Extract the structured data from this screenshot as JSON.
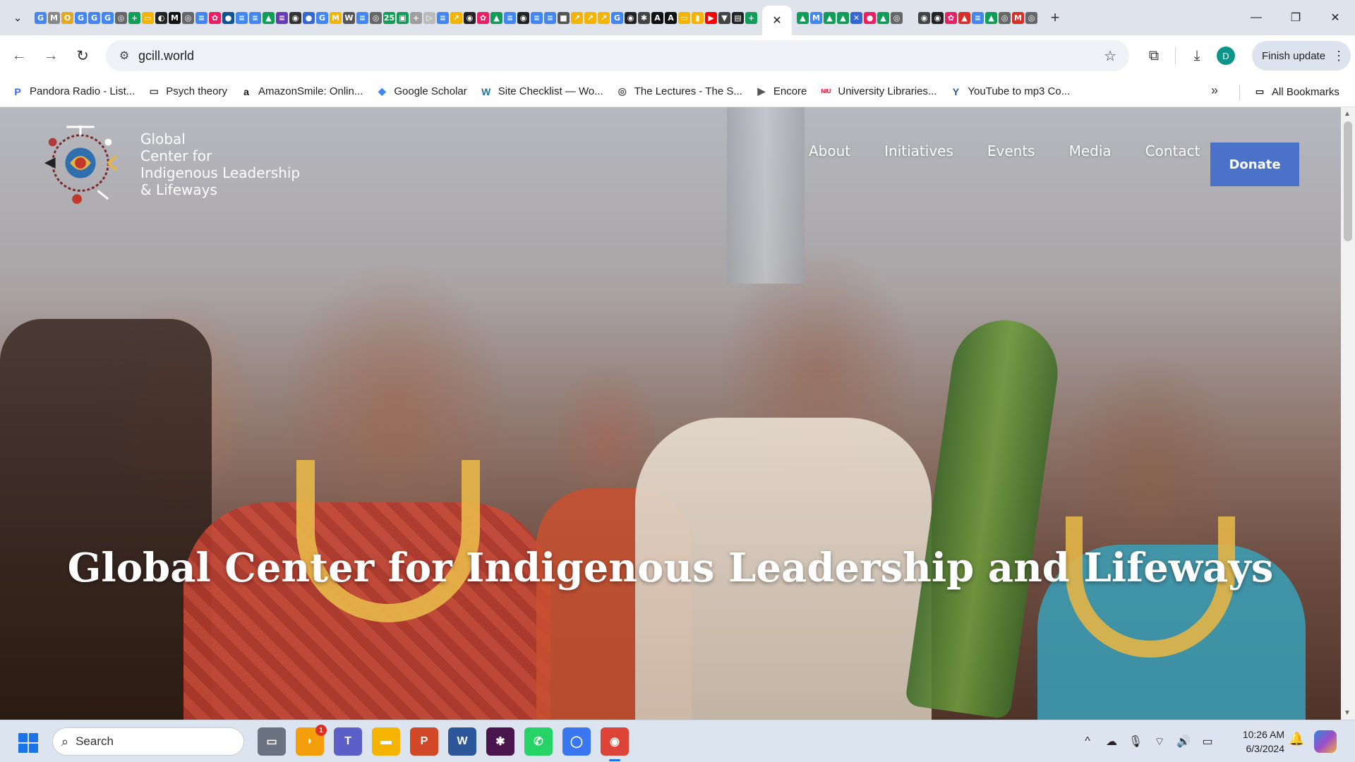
{
  "browser": {
    "tabstrip": {
      "favicons": [
        {
          "glyph": "G",
          "color": "#4285f4"
        },
        {
          "glyph": "M",
          "color": "#888888"
        },
        {
          "glyph": "O",
          "color": "#e3a81b"
        },
        {
          "glyph": "G",
          "color": "#4285f4"
        },
        {
          "glyph": "G",
          "color": "#4285f4"
        },
        {
          "glyph": "G",
          "color": "#4285f4"
        },
        {
          "glyph": "◎",
          "color": "#666666"
        },
        {
          "glyph": "+",
          "color": "#0f9d58"
        },
        {
          "glyph": "▭",
          "color": "#f4b400"
        },
        {
          "glyph": "◐",
          "color": "#222222"
        },
        {
          "glyph": "M",
          "color": "#111111"
        },
        {
          "glyph": "◎",
          "color": "#666666"
        },
        {
          "glyph": "≡",
          "color": "#4285f4"
        },
        {
          "glyph": "✿",
          "color": "#e91e63"
        },
        {
          "glyph": "●",
          "color": "#0b5394"
        },
        {
          "glyph": "≡",
          "color": "#4285f4"
        },
        {
          "glyph": "≡",
          "color": "#4285f4"
        },
        {
          "glyph": "▲",
          "color": "#0f9d58"
        },
        {
          "glyph": "≡",
          "color": "#673ab7"
        },
        {
          "glyph": "◉",
          "color": "#333333"
        },
        {
          "glyph": "●",
          "color": "#3367d6"
        },
        {
          "glyph": "G",
          "color": "#4285f4"
        },
        {
          "glyph": "M",
          "color": "#f4b400"
        },
        {
          "glyph": "W",
          "color": "#555555"
        },
        {
          "glyph": "≡",
          "color": "#4285f4"
        },
        {
          "glyph": "◎",
          "color": "#666666"
        },
        {
          "glyph": "25",
          "color": "#0f9d58"
        },
        {
          "glyph": "▣",
          "color": "#0f9d58"
        },
        {
          "glyph": "+",
          "color": "#9e9e9e"
        },
        {
          "glyph": "▷",
          "color": "#bbbbbb"
        },
        {
          "glyph": "≡",
          "color": "#4285f4"
        },
        {
          "glyph": "↗",
          "color": "#f4b400"
        },
        {
          "glyph": "◉",
          "color": "#222222"
        },
        {
          "glyph": "✿",
          "color": "#e91e63"
        },
        {
          "glyph": "▲",
          "color": "#0f9d58"
        },
        {
          "glyph": "≡",
          "color": "#4285f4"
        },
        {
          "glyph": "◉",
          "color": "#222222"
        },
        {
          "glyph": "≡",
          "color": "#4285f4"
        },
        {
          "glyph": "≡",
          "color": "#4285f4"
        },
        {
          "glyph": "■",
          "color": "#555555"
        },
        {
          "glyph": "↗",
          "color": "#f4b400"
        },
        {
          "glyph": "↗",
          "color": "#f4b400"
        },
        {
          "glyph": "↗",
          "color": "#f4b400"
        },
        {
          "glyph": "G",
          "color": "#4285f4"
        },
        {
          "glyph": "◉",
          "color": "#222222"
        },
        {
          "glyph": "✱",
          "color": "#444444"
        },
        {
          "glyph": "A",
          "color": "#111111"
        },
        {
          "glyph": "A",
          "color": "#111111"
        },
        {
          "glyph": "▭",
          "color": "#f4b400"
        },
        {
          "glyph": "▮",
          "color": "#f4b400"
        },
        {
          "glyph": "▶",
          "color": "#ff0000"
        },
        {
          "glyph": "▼",
          "color": "#444444"
        },
        {
          "glyph": "▤",
          "color": "#222222"
        },
        {
          "glyph": "+",
          "color": "#0f9d58"
        }
      ],
      "active_tab_close": "✕",
      "favicons_after": [
        {
          "glyph": "▲",
          "color": "#0f9d58"
        },
        {
          "glyph": "M",
          "color": "#4285f4"
        },
        {
          "glyph": "▲",
          "color": "#0f9d58"
        },
        {
          "glyph": "▲",
          "color": "#0f9d58"
        },
        {
          "glyph": "✕",
          "color": "#3367d6"
        },
        {
          "glyph": "●",
          "color": "#e91e63"
        },
        {
          "glyph": "▲",
          "color": "#0f9d58"
        },
        {
          "glyph": "◎",
          "color": "#666666"
        }
      ],
      "favicons_after2": [
        {
          "glyph": "◉",
          "color": "#444444"
        },
        {
          "glyph": "◉",
          "color": "#222222"
        },
        {
          "glyph": "✿",
          "color": "#e91e63"
        },
        {
          "glyph": "▲",
          "color": "#d93025"
        },
        {
          "glyph": "≡",
          "color": "#4285f4"
        },
        {
          "glyph": "▲",
          "color": "#0f9d58"
        },
        {
          "glyph": "◎",
          "color": "#666666"
        },
        {
          "glyph": "M",
          "color": "#d93025"
        },
        {
          "glyph": "◎",
          "color": "#666666"
        }
      ],
      "new_tab": "+",
      "window_controls": {
        "minimize": "—",
        "restore": "❐",
        "close": "✕"
      }
    },
    "toolbar": {
      "back": "←",
      "forward": "→",
      "reload": "↻",
      "site_info": "⚙",
      "url": "gcill.world",
      "bookmark_star": "☆",
      "extensions": "⧉",
      "download": "⤓",
      "profile_initial": "D",
      "finish_update_label": "Finish update",
      "menu": "⋮"
    },
    "bookmarks": {
      "items": [
        {
          "label": "Pandora Radio - List...",
          "icon": "P",
          "color": "#3668ff"
        },
        {
          "label": "Psych theory",
          "icon": "▭",
          "color": "#444444"
        },
        {
          "label": "AmazonSmile: Onlin...",
          "icon": "a",
          "color": "#111111"
        },
        {
          "label": "Google Scholar",
          "icon": "◆",
          "color": "#4285f4"
        },
        {
          "label": "Site Checklist — Wo...",
          "icon": "W",
          "color": "#21759b"
        },
        {
          "label": "The Lectures - The S...",
          "icon": "◎",
          "color": "#555555"
        },
        {
          "label": "Encore",
          "icon": "▶",
          "color": "#555555"
        },
        {
          "label": "University Libraries...",
          "icon": "NIU",
          "color": "#c8102e"
        },
        {
          "label": "YouTube to mp3 Co...",
          "icon": "Y",
          "color": "#2b5797"
        }
      ],
      "more": "»",
      "all_bookmarks_label": "All Bookmarks"
    }
  },
  "page": {
    "logo_text_lines": [
      "Global",
      "Center for",
      "Indigenous Leadership",
      "& Lifeways"
    ],
    "nav": [
      "About",
      "Initiatives",
      "Events",
      "Media",
      "Contact"
    ],
    "donate_label": "Donate",
    "hero_title": "Global Center for Indigenous Leadership and Lifeways",
    "scroll_up": "▲",
    "scroll_down": "▼"
  },
  "taskbar": {
    "search_label": "Search",
    "apps": [
      {
        "name": "task-view",
        "glyph": "▭",
        "color": "#6b7280"
      },
      {
        "name": "widget-app",
        "glyph": "◗",
        "color": "#f59e0b",
        "badge": "1"
      },
      {
        "name": "teams",
        "glyph": "T",
        "color": "#5b5fc7"
      },
      {
        "name": "file-explorer",
        "glyph": "▬",
        "color": "#f4b400"
      },
      {
        "name": "powerpoint",
        "glyph": "P",
        "color": "#d24726"
      },
      {
        "name": "word",
        "glyph": "W",
        "color": "#2b579a"
      },
      {
        "name": "slack",
        "glyph": "✱",
        "color": "#4a154b"
      },
      {
        "name": "whatsapp",
        "glyph": "✆",
        "color": "#25d366"
      },
      {
        "name": "signal",
        "glyph": "◯",
        "color": "#3a76f0"
      },
      {
        "name": "chrome",
        "glyph": "◉",
        "color": "#db4437",
        "active": true
      }
    ],
    "tray": {
      "chevron": "^",
      "cloud": "☁",
      "mic": "🎙",
      "wifi": "⌔",
      "volume": "🔊",
      "battery": "▭"
    },
    "time": "10:26 AM",
    "date": "6/3/2024",
    "bell": "🔔"
  }
}
